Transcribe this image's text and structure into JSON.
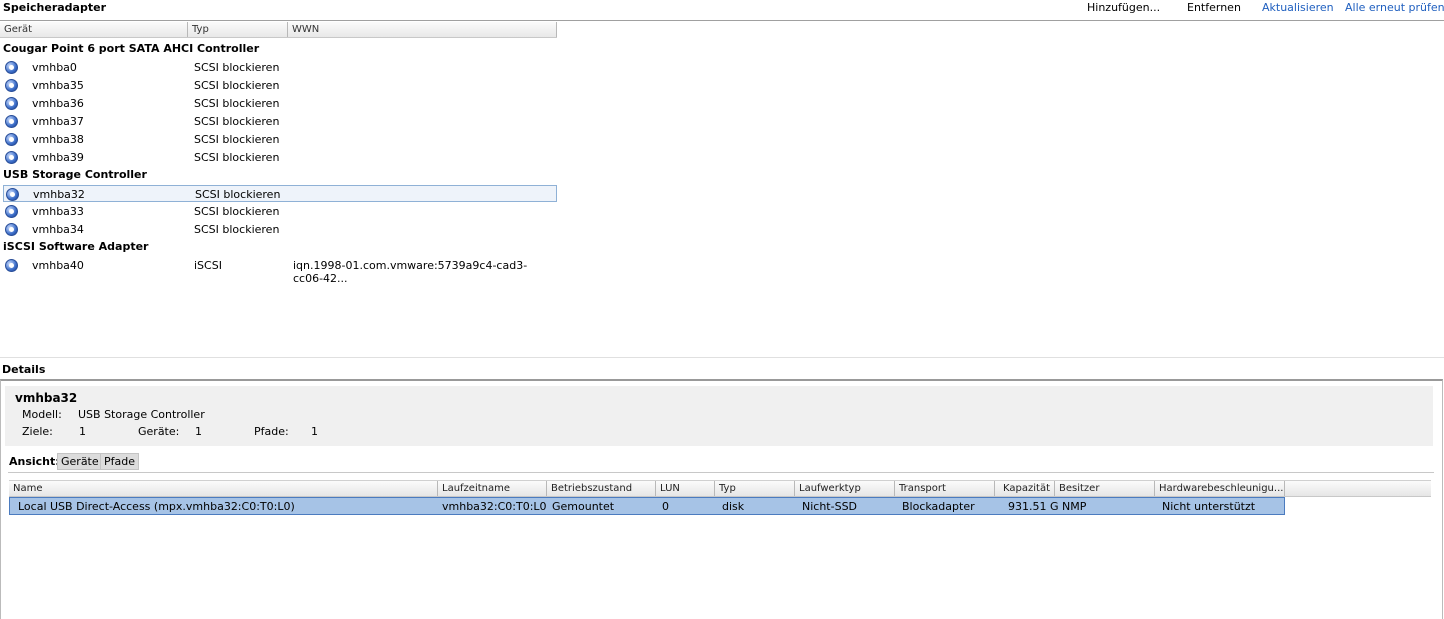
{
  "header": {
    "title": "Speicheradapter",
    "actions": {
      "add": "Hinzufügen...",
      "remove": "Entfernen",
      "refresh": "Aktualisieren",
      "rescan": "Alle erneut prüfen..."
    }
  },
  "adapter_table": {
    "columns": [
      "Gerät",
      "Typ",
      "WWN"
    ],
    "groups": [
      {
        "name": "Cougar Point 6 port SATA AHCI Controller",
        "rows": [
          {
            "device": "vmhba0",
            "type": "SCSI blockieren",
            "wwn": ""
          },
          {
            "device": "vmhba35",
            "type": "SCSI blockieren",
            "wwn": ""
          },
          {
            "device": "vmhba36",
            "type": "SCSI blockieren",
            "wwn": ""
          },
          {
            "device": "vmhba37",
            "type": "SCSI blockieren",
            "wwn": ""
          },
          {
            "device": "vmhba38",
            "type": "SCSI blockieren",
            "wwn": ""
          },
          {
            "device": "vmhba39",
            "type": "SCSI blockieren",
            "wwn": ""
          }
        ]
      },
      {
        "name": "USB Storage Controller",
        "rows": [
          {
            "device": "vmhba32",
            "type": "SCSI blockieren",
            "wwn": "",
            "selected": true
          },
          {
            "device": "vmhba33",
            "type": "SCSI blockieren",
            "wwn": ""
          },
          {
            "device": "vmhba34",
            "type": "SCSI blockieren",
            "wwn": ""
          }
        ]
      },
      {
        "name": "iSCSI Software Adapter",
        "rows": [
          {
            "device": "vmhba40",
            "type": "iSCSI",
            "wwn": "iqn.1998-01.com.vmware:5739a9c4-cad3-cc06-42..."
          }
        ]
      }
    ]
  },
  "details": {
    "title": "Details",
    "adapter_name": "vmhba32",
    "model_label": "Modell:",
    "model_value": "USB Storage Controller",
    "targets_label": "Ziele:",
    "targets_value": "1",
    "devices_label": "Geräte:",
    "devices_value": "1",
    "paths_label": "Pfade:",
    "paths_value": "1",
    "view_label": "Ansicht:",
    "view_devices": "Geräte",
    "view_paths": "Pfade"
  },
  "device_grid": {
    "columns": [
      "Name",
      "Laufzeitname",
      "Betriebszustand",
      "LUN",
      "Typ",
      "Laufwerktyp",
      "Transport",
      "Kapazität",
      "Besitzer",
      "Hardwarebeschleunigu..."
    ],
    "rows": [
      [
        "Local USB Direct-Access (mpx.vmhba32:C0:T0:L0)",
        "vmhba32:C0:T0:L0",
        "Gemountet",
        "0",
        "disk",
        "Nicht-SSD",
        "Blockadapter",
        "931.51 G",
        "NMP",
        "Nicht unterstützt"
      ]
    ]
  },
  "icon": "adapter-icon"
}
